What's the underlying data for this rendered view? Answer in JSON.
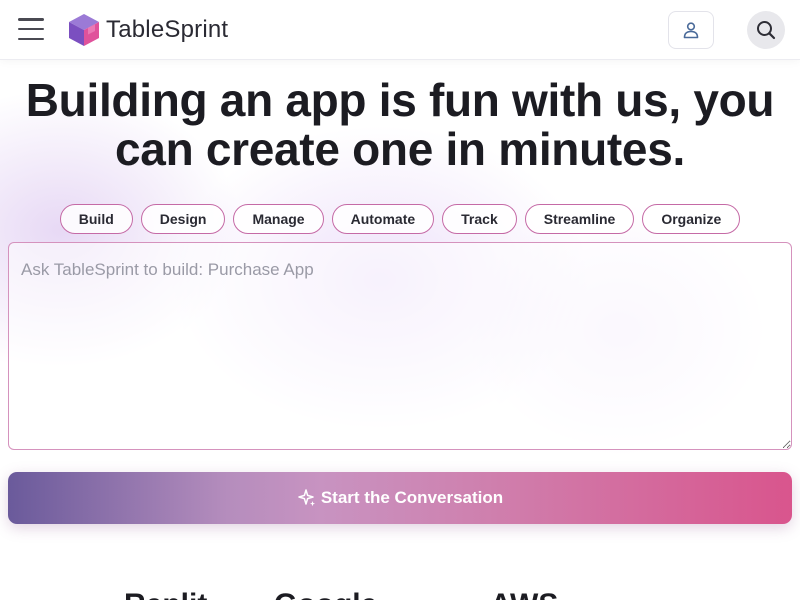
{
  "header": {
    "brand_name": "TableSprint",
    "menu_icon": "hamburger-icon",
    "logo_icon": "cube-logo",
    "user_icon": "user-icon",
    "search_icon": "search-icon"
  },
  "hero": {
    "headline_line1": "Building an app is fun with us, you",
    "headline_line2": "can create one in minutes."
  },
  "chips": [
    {
      "label": "Build"
    },
    {
      "label": "Design"
    },
    {
      "label": "Manage"
    },
    {
      "label": "Automate"
    },
    {
      "label": "Track"
    },
    {
      "label": "Streamline"
    },
    {
      "label": "Organize"
    }
  ],
  "prompt": {
    "placeholder": "Ask TableSprint to build: Purchase App",
    "value": ""
  },
  "cta": {
    "label": "Start the Conversation",
    "icon": "sparkle-icon"
  },
  "partners": [
    {
      "label": "Replit"
    },
    {
      "label": "Google"
    },
    {
      "label": "AWS"
    }
  ],
  "colors": {
    "chip_border": "#c56aa6",
    "cta_start": "#6a5a9b",
    "cta_end": "#d9558d",
    "logo_purple": "#7b4fc0",
    "logo_pink": "#e0529b"
  }
}
